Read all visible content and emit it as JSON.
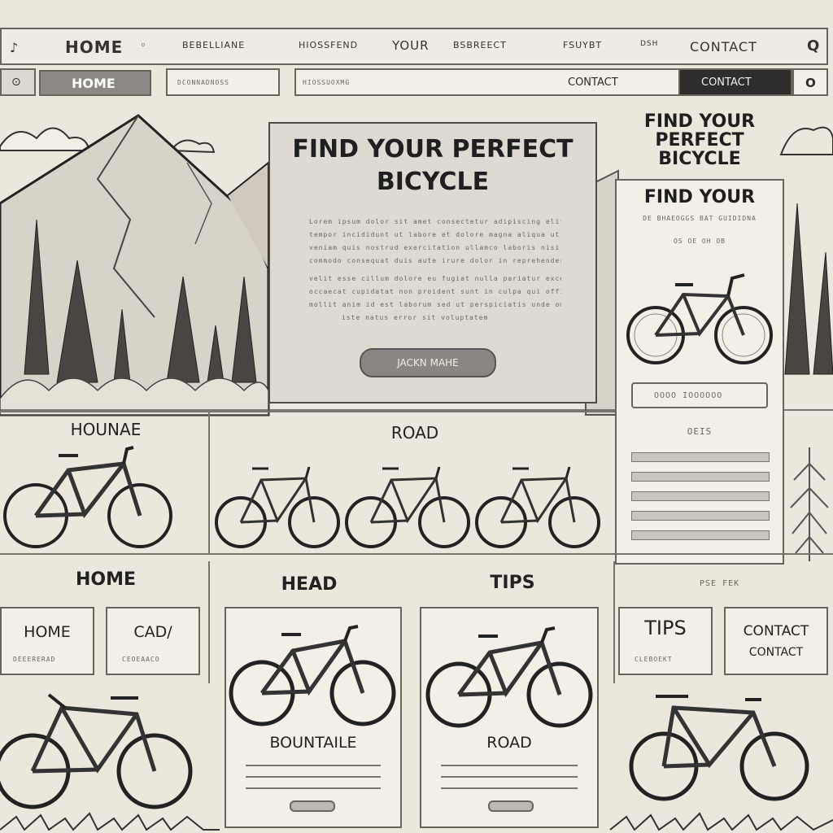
{
  "nav": {
    "row1": {
      "logo": "♪",
      "home": "HOME",
      "item2": "BEBELLIANE",
      "item3": "HIOSSFEND",
      "item4": "YOUR",
      "item5": "BSBREECT",
      "item6": "FSUYBT",
      "item7": "DSH",
      "contact": "CONTACT",
      "search": "Q"
    },
    "row2": {
      "home": "HOME",
      "field1": "DCONNADNOSS",
      "field2": "HIOSSUOXMG",
      "contact": "CONTACT",
      "contact_dark": "CONTACT",
      "search": "O"
    }
  },
  "hero": {
    "title": "FIND YOUR PERFECT BICYCLE",
    "body": [
      "Lorem ipsum dolor sit amet consectetur adipiscing elit sed do eiusmod",
      "tempor incididunt ut labore et dolore magna aliqua ut enim ad minim",
      "veniam quis nostrud exercitation ullamco laboris nisi ut aliquip ex ea",
      "commodo consequat duis aute irure dolor in reprehenderit in voluptate",
      "velit esse cillum dolore eu fugiat nulla pariatur excepteur sint",
      "occaecat cupidatat non proident sunt in culpa qui officia deserunt",
      "mollit anim id est laborum sed ut perspiciatis unde omnis",
      "iste natus error sit voluptatem"
    ],
    "button": "JACKN MAHE"
  },
  "sidebar": {
    "heading": "FIND YOUR PERFECT BICYCLE",
    "card_title": "FIND YOUR",
    "card_sub": "DE BHAEOGGS BAT GUIDIDNA",
    "card_sub2": "OS OE OH OB",
    "card_button": "OOOO IOOOOOO",
    "section_label": "OEIS"
  },
  "categories": {
    "row1": {
      "left": "HOUNAE",
      "center": "ROAD"
    },
    "row2": {
      "home": "HOME",
      "head": "HEAD",
      "tips": "TIPS",
      "right_caption": "PSE FEK"
    }
  },
  "cards": {
    "home": {
      "label": "HOME",
      "sub": "DEEERERAD"
    },
    "cadi": {
      "label": "CAD/",
      "sub": "CEOEAACO"
    },
    "mountain": {
      "label": "BOUNTAILE"
    },
    "road": {
      "label": "ROAD"
    },
    "tips": {
      "label": "TIPS",
      "sub": "CLEBOEKT"
    },
    "contact": {
      "label": "CONTACT",
      "label2": "CONTACT"
    }
  }
}
